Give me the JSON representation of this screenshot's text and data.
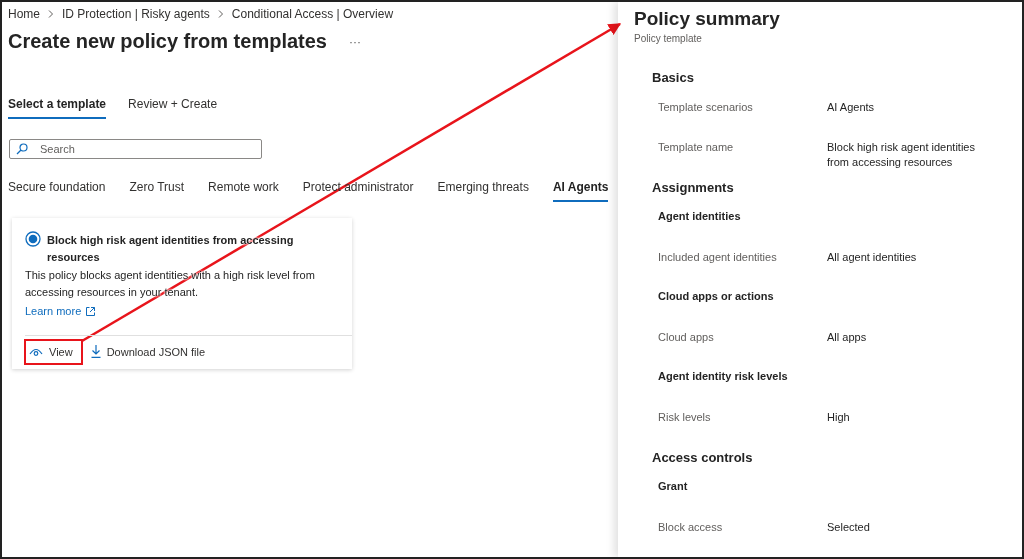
{
  "breadcrumb": [
    "Home",
    "ID Protection | Risky agents",
    "Conditional Access | Overview"
  ],
  "page_title": "Create new policy from templates",
  "more_button": "···",
  "wizard_tabs": [
    {
      "label": "Select a template",
      "selected": true
    },
    {
      "label": "Review + Create",
      "selected": false
    }
  ],
  "search": {
    "placeholder": "Search"
  },
  "categories": [
    {
      "label": "Secure foundation",
      "selected": false
    },
    {
      "label": "Zero Trust",
      "selected": false
    },
    {
      "label": "Remote work",
      "selected": false
    },
    {
      "label": "Protect administrator",
      "selected": false
    },
    {
      "label": "Emerging threats",
      "selected": false
    },
    {
      "label": "AI Agents",
      "selected": true
    }
  ],
  "template_card": {
    "selected": true,
    "title": "Block high risk agent identities from accessing resources",
    "description": "This policy blocks agent identities with a high risk level from accessing resources in your tenant.",
    "link": "Learn more",
    "actions": [
      "View",
      "Download JSON file"
    ]
  },
  "summary": {
    "title": "Policy summary",
    "subtitle": "Policy template",
    "items": [
      {
        "kind": "section",
        "text": "Basics"
      },
      {
        "kind": "row",
        "label": "Template scenarios",
        "value": "AI Agents"
      },
      {
        "kind": "row",
        "label": "Template name",
        "value": "Block high risk agent identities from accessing resources"
      },
      {
        "kind": "section",
        "text": "Assignments"
      },
      {
        "kind": "subheading",
        "text": "Agent identities"
      },
      {
        "kind": "row",
        "label": "Included agent identities",
        "value": "All agent identities"
      },
      {
        "kind": "subheading",
        "text": "Cloud apps or actions"
      },
      {
        "kind": "row",
        "label": "Cloud apps",
        "value": "All apps"
      },
      {
        "kind": "subheading",
        "text": "Agent identity risk levels"
      },
      {
        "kind": "row",
        "label": "Risk levels",
        "value": "High"
      },
      {
        "kind": "section",
        "text": "Access controls"
      },
      {
        "kind": "subheading",
        "text": "Grant"
      },
      {
        "kind": "row",
        "label": "Block access",
        "value": "Selected"
      }
    ]
  }
}
